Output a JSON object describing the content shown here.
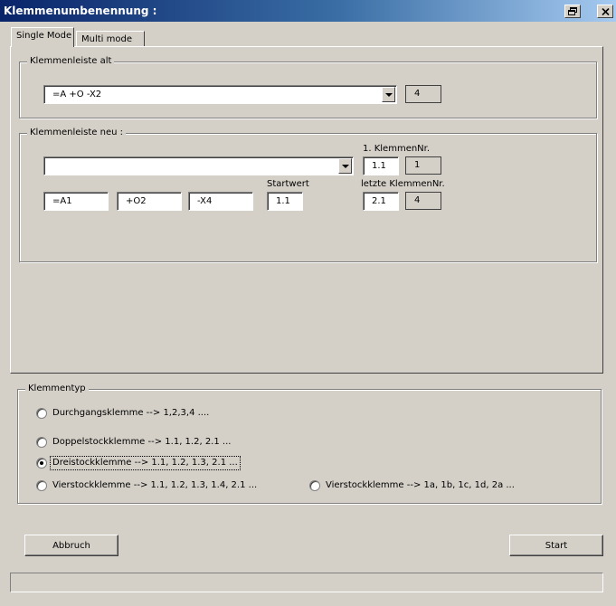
{
  "window": {
    "title": "Klemmenumbenennung :",
    "restore_icon": "restore-icon",
    "close_icon": "close-icon"
  },
  "tabs": [
    {
      "label": "Single Mode",
      "active": true
    },
    {
      "label": "Multi mode",
      "active": false
    }
  ],
  "alt_group": {
    "title": "Klemmenleiste alt",
    "combo_value": "=A +O -X2",
    "count": "4"
  },
  "neu_group": {
    "title": "Klemmenleiste neu :",
    "combo_value": "",
    "first_label": "1. KlemmenNr.",
    "first_value": "1.1",
    "first_readonly": "1",
    "start_label": "Startwert",
    "start_value": "1.1",
    "last_label": "letzte KlemmenNr.",
    "last_value": "2.1",
    "last_readonly": "4",
    "field_a": "=A1",
    "field_o": "+O2",
    "field_x": "-X4"
  },
  "typ_group": {
    "title": "Klemmentyp",
    "options": [
      {
        "label": "Durchgangsklemme  --> 1,2,3,4 ....",
        "checked": false
      },
      {
        "label": "Doppelstockklemme --> 1.1, 1.2, 2.1 ...",
        "checked": false
      },
      {
        "label": "Dreistockklemme   --> 1.1, 1.2, 1.3, 2.1 ...",
        "checked": true
      },
      {
        "label": "Vierstockklemme   --> 1.1, 1.2, 1.3, 1.4, 2.1 ...",
        "checked": false
      },
      {
        "label": "Vierstockklemme   --> 1a, 1b, 1c, 1d, 2a ...",
        "checked": false
      }
    ]
  },
  "buttons": {
    "cancel": "Abbruch",
    "start": "Start"
  },
  "status": ""
}
